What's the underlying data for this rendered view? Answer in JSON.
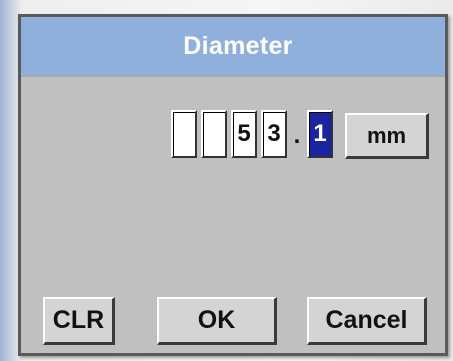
{
  "dialog": {
    "title": "Diameter"
  },
  "input": {
    "digits": [
      "",
      "",
      "5",
      "3"
    ],
    "decimal_separator": ".",
    "decimal_digit": "1",
    "selected_position": "decimal",
    "unit_label": "mm"
  },
  "buttons": {
    "clear_label": "CLR",
    "ok_label": "OK",
    "cancel_label": "Cancel"
  },
  "colors": {
    "title_bar": "#8fb0dd",
    "dialog_background": "#c0c0c0",
    "selected_digit": "#1a24a0"
  }
}
